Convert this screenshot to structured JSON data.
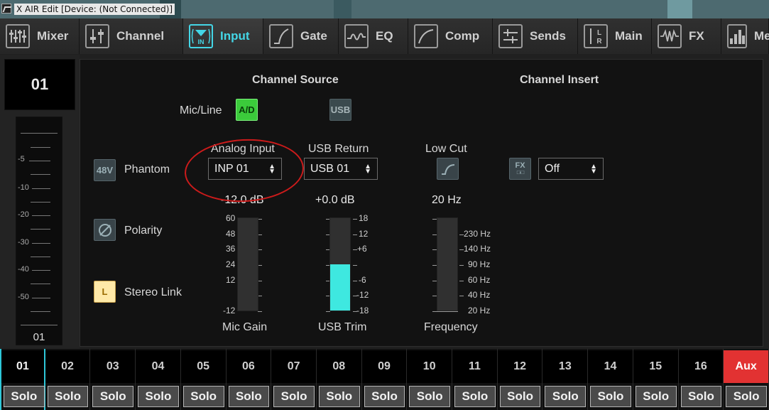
{
  "window": {
    "title": "X AIR Edit [Device: (Not Connected)]"
  },
  "tabs": [
    {
      "label": "Mixer",
      "icon": "mixer-icon"
    },
    {
      "label": "Channel",
      "icon": "channel-icon"
    },
    {
      "label": "Input",
      "icon": "input-icon",
      "active": true
    },
    {
      "label": "Gate",
      "icon": "gate-icon"
    },
    {
      "label": "EQ",
      "icon": "eq-icon"
    },
    {
      "label": "Comp",
      "icon": "comp-icon"
    },
    {
      "label": "Sends",
      "icon": "sends-icon"
    },
    {
      "label": "Main",
      "icon": "main-icon"
    },
    {
      "label": "FX",
      "icon": "fx-icon"
    },
    {
      "label": "Me",
      "icon": "meters-icon"
    }
  ],
  "channel": {
    "number": "01",
    "meter_footer": "01"
  },
  "meter_scale": [
    "-5",
    "-10",
    "-20",
    "-30",
    "-40",
    "-50"
  ],
  "source": {
    "header": "Channel Source",
    "mic_line_label": "Mic/Line",
    "ad_label": "A/D",
    "usb_label": "USB",
    "analog_input_label": "Analog Input",
    "analog_input_value": "INP 01",
    "usb_return_label": "USB Return",
    "usb_return_value": "USB 01",
    "low_cut_label": "Low Cut"
  },
  "insert": {
    "header": "Channel Insert",
    "fx_label": "FX",
    "value": "Off"
  },
  "switches": {
    "phantom_btn": "48V",
    "phantom_label": "Phantom",
    "polarity_label": "Polarity",
    "stereo_btn": "L",
    "stereo_label": "Stereo Link"
  },
  "mic_gain": {
    "readout": "-12.0 dB",
    "label": "Mic Gain",
    "scale": [
      "60",
      "48",
      "36",
      "24",
      "12",
      "-12"
    ],
    "level": 0
  },
  "usb_trim": {
    "readout": "+0.0 dB",
    "label": "USB Trim",
    "scale": [
      "18",
      "12",
      "+6",
      "-6",
      "-12",
      "-18"
    ],
    "level": 0.5
  },
  "frequency": {
    "readout": "20 Hz",
    "label": "Frequency",
    "scale": [
      "230 Hz",
      "140 Hz",
      "90 Hz",
      "60 Hz",
      "40 Hz",
      "20 Hz"
    ],
    "level": 0
  },
  "strip": {
    "channels": [
      "01",
      "02",
      "03",
      "04",
      "05",
      "06",
      "07",
      "08",
      "09",
      "10",
      "11",
      "12",
      "13",
      "14",
      "15",
      "16",
      "Aux"
    ],
    "solo_label": "Solo",
    "selected": "01"
  },
  "colors": {
    "accent": "#44d6e6",
    "ad_green": "#3bcb3b",
    "aux_red": "#e23232",
    "trim_fill": "#3ee8e0"
  }
}
